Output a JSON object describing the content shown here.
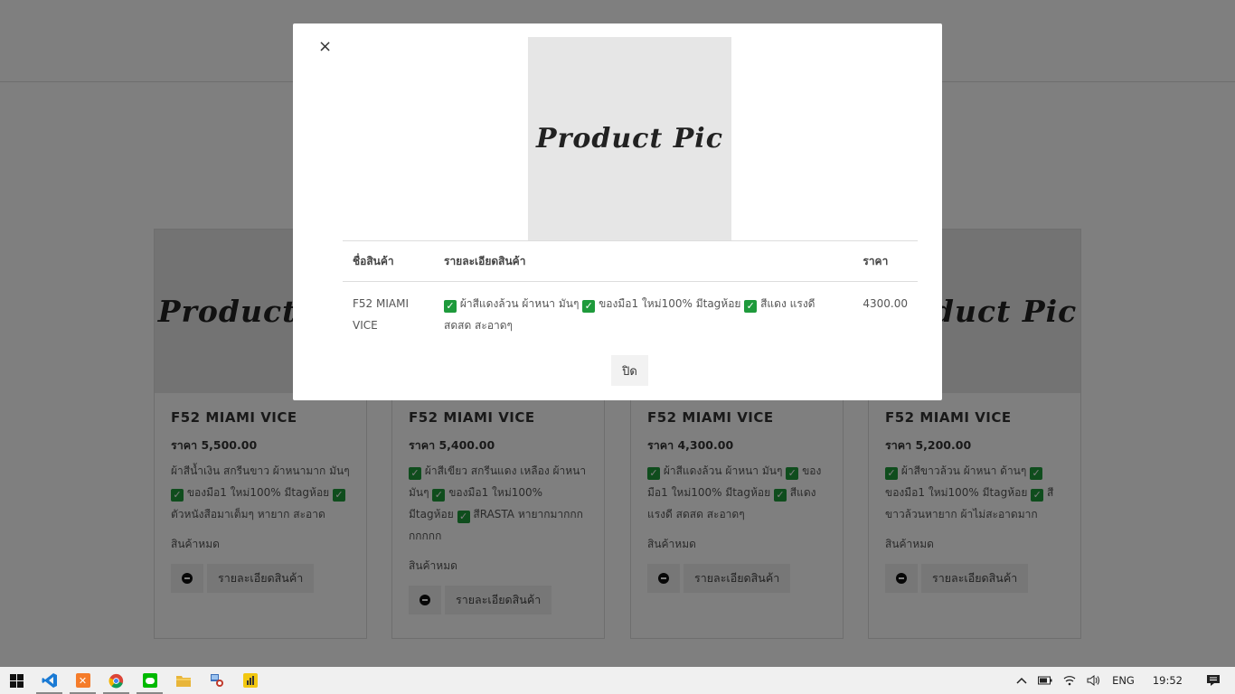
{
  "product_image_text": "Product Pic",
  "modal": {
    "close_symbol": "×",
    "image_label": "Product Pic",
    "table": {
      "headers": [
        "ชื่อสินค้า",
        "รายละเอียดสินค้า",
        "ราคา"
      ],
      "row": {
        "name": "F52 MIAMI VICE",
        "detail_parts": [
          "ผ้าสีแดงล้วน ผ้าหนา มันๆ",
          "ของมือ1 ใหม่100% มีtagห้อย",
          "สีแดง แรงดี สดสด สะอาดๆ"
        ],
        "price": "4300.00"
      }
    },
    "close_button": "ปิด"
  },
  "cards": [
    {
      "name": "F52 MIAMI VICE",
      "price": "ราคา 5,500.00",
      "desc_parts": [
        "ผ้าสีน้ำเงิน สกรีนขาว ผ้าหนามาก มันๆ",
        "ของมือ1 ใหม่100% มีtagห้อย",
        "ตัวหนังสือมาเต็มๆ หายาก สะอาด"
      ],
      "desc_lead_check": false,
      "stock": "สินค้าหมด",
      "detail_button": "รายละเอียดสินค้า"
    },
    {
      "name": "F52 MIAMI VICE",
      "price": "ราคา 5,400.00",
      "desc_parts": [
        "ผ้าสีเขียว สกรีนแดง เหลือง ผ้าหนา มันๆ",
        "ของมือ1 ใหม่100% มีtagห้อย",
        "สีRASTA หายากมากกกกกกกก"
      ],
      "desc_lead_check": true,
      "stock": "สินค้าหมด",
      "detail_button": "รายละเอียดสินค้า"
    },
    {
      "name": "F52 MIAMI VICE",
      "price": "ราคา 4,300.00",
      "desc_parts": [
        "ผ้าสีแดงล้วน ผ้าหนา มันๆ",
        "ของมือ1 ใหม่100% มีtagห้อย",
        "สีแดง แรงดี สดสด สะอาดๆ"
      ],
      "desc_lead_check": true,
      "stock": "สินค้าหมด",
      "detail_button": "รายละเอียดสินค้า"
    },
    {
      "name": "F52 MIAMI VICE",
      "price": "ราคา 5,200.00",
      "desc_parts": [
        "ผ้าสีขาวล้วน ผ้าหนา ด้านๆ",
        "ของมือ1 ใหม่100% มีtagห้อย",
        "สีขาวล้วนหายาก ผ้าไม่สะอาดมาก"
      ],
      "desc_lead_check": true,
      "stock": "สินค้าหมด",
      "detail_button": "รายละเอียดสินค้า"
    }
  ],
  "taskbar": {
    "apps": [
      "windows-start",
      "vscode",
      "xampp",
      "chrome",
      "line",
      "file-explorer",
      "network-tool",
      "power-bi"
    ],
    "language": "ENG",
    "time": "19:52"
  }
}
